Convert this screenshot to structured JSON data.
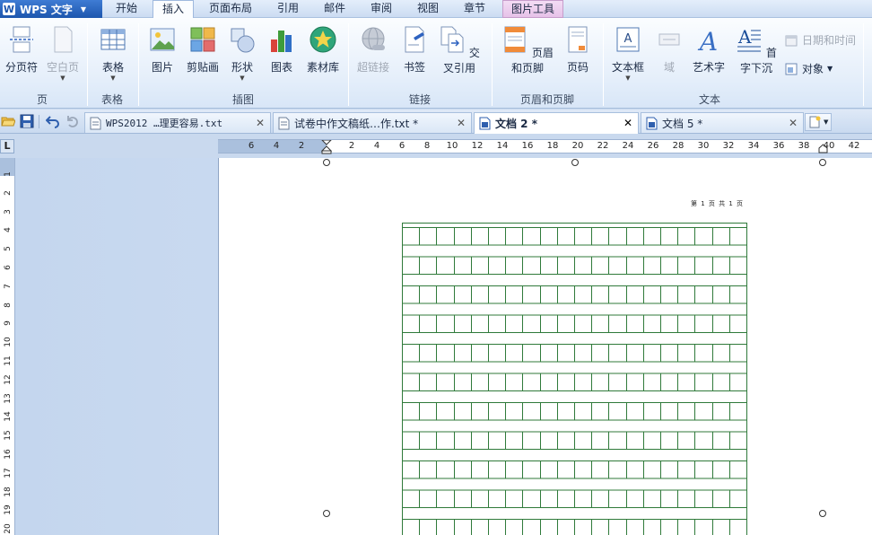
{
  "app": {
    "name": "WPS 文字",
    "logo_letter": "W"
  },
  "menu_tabs": [
    {
      "label": "开始"
    },
    {
      "label": "插入"
    },
    {
      "label": "页面布局"
    },
    {
      "label": "引用"
    },
    {
      "label": "邮件"
    },
    {
      "label": "审阅"
    },
    {
      "label": "视图"
    },
    {
      "label": "章节"
    },
    {
      "label": "图片工具"
    }
  ],
  "ribbon": {
    "page_group": {
      "label": "页",
      "page_break": "分页符",
      "blank_page": "空白页"
    },
    "table_group": {
      "label": "表格",
      "table": "表格"
    },
    "illustration_group": {
      "label": "插图",
      "picture": "图片",
      "clipart": "剪贴画",
      "shapes": "形状",
      "chart": "图表",
      "material": "素材库"
    },
    "link_group": {
      "label": "链接",
      "hyperlink": "超链接",
      "bookmark": "书签",
      "crossref": "交叉引用"
    },
    "header_group": {
      "label": "页眉和页脚",
      "header_footer": "页眉和页脚",
      "page_number": "页码"
    },
    "text_group": {
      "label": "文本",
      "textbox": "文本框",
      "field": "域",
      "wordart": "艺术字",
      "dropcap": "首字下沉",
      "datetime": "日期和时间",
      "object": "对象"
    }
  },
  "doc_tabs": [
    {
      "label": "WPS2012 …理更容易.txt"
    },
    {
      "label": "试卷中作文稿纸…作.txt *"
    },
    {
      "label": "文档 2 *"
    },
    {
      "label": "文档 5 *"
    }
  ],
  "ruler": {
    "corner": "L",
    "h_numbers": [
      "6",
      "4",
      "2",
      "2",
      "4",
      "6",
      "8",
      "10",
      "12",
      "14",
      "16",
      "18",
      "20",
      "22",
      "24",
      "26",
      "28",
      "30",
      "32",
      "34",
      "36",
      "38",
      "40",
      "42"
    ],
    "v_numbers": [
      "1",
      "2",
      "3",
      "4",
      "5",
      "6",
      "7",
      "8",
      "9",
      "10",
      "11",
      "12",
      "13",
      "14",
      "15",
      "16",
      "17",
      "18",
      "19",
      "20"
    ]
  },
  "page": {
    "header_text": "第 1 页 共 1 页"
  },
  "grid": {
    "cols": 20,
    "line_color": "#2f7a3a"
  },
  "colors": {
    "accent": "#1d56ad",
    "tool_tab": "#e6c2e8"
  }
}
